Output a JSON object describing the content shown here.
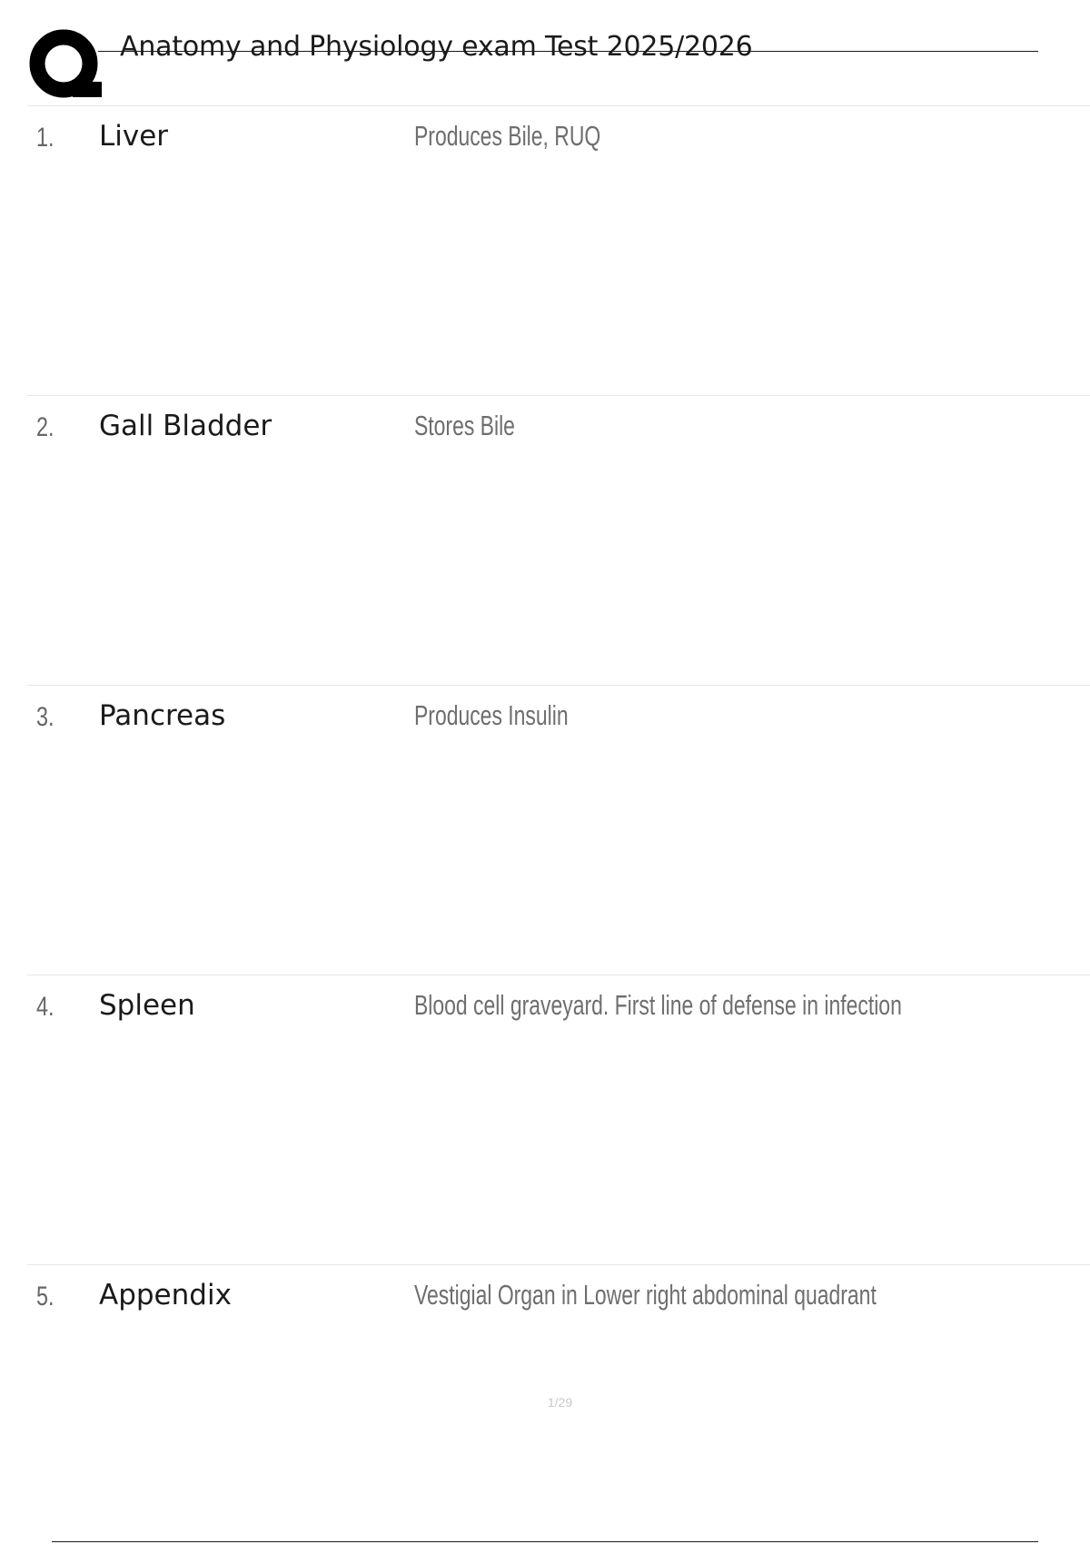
{
  "document": {
    "title": "Anatomy and Physiology exam Test 2025/2026",
    "page_indicator": "1/29"
  },
  "cards": [
    {
      "number": "1.",
      "term": "Liver",
      "definition": "Produces Bile, RUQ"
    },
    {
      "number": "2.",
      "term": "Gall Bladder",
      "definition": "Stores Bile"
    },
    {
      "number": "3.",
      "term": "Pancreas",
      "definition": "Produces Insulin"
    },
    {
      "number": "4.",
      "term": "Spleen",
      "definition": "Blood cell graveyard. First line of defense in infection"
    },
    {
      "number": "5.",
      "term": "Appendix",
      "definition": "Vestigial Organ in Lower right abdominal quadrant"
    }
  ]
}
